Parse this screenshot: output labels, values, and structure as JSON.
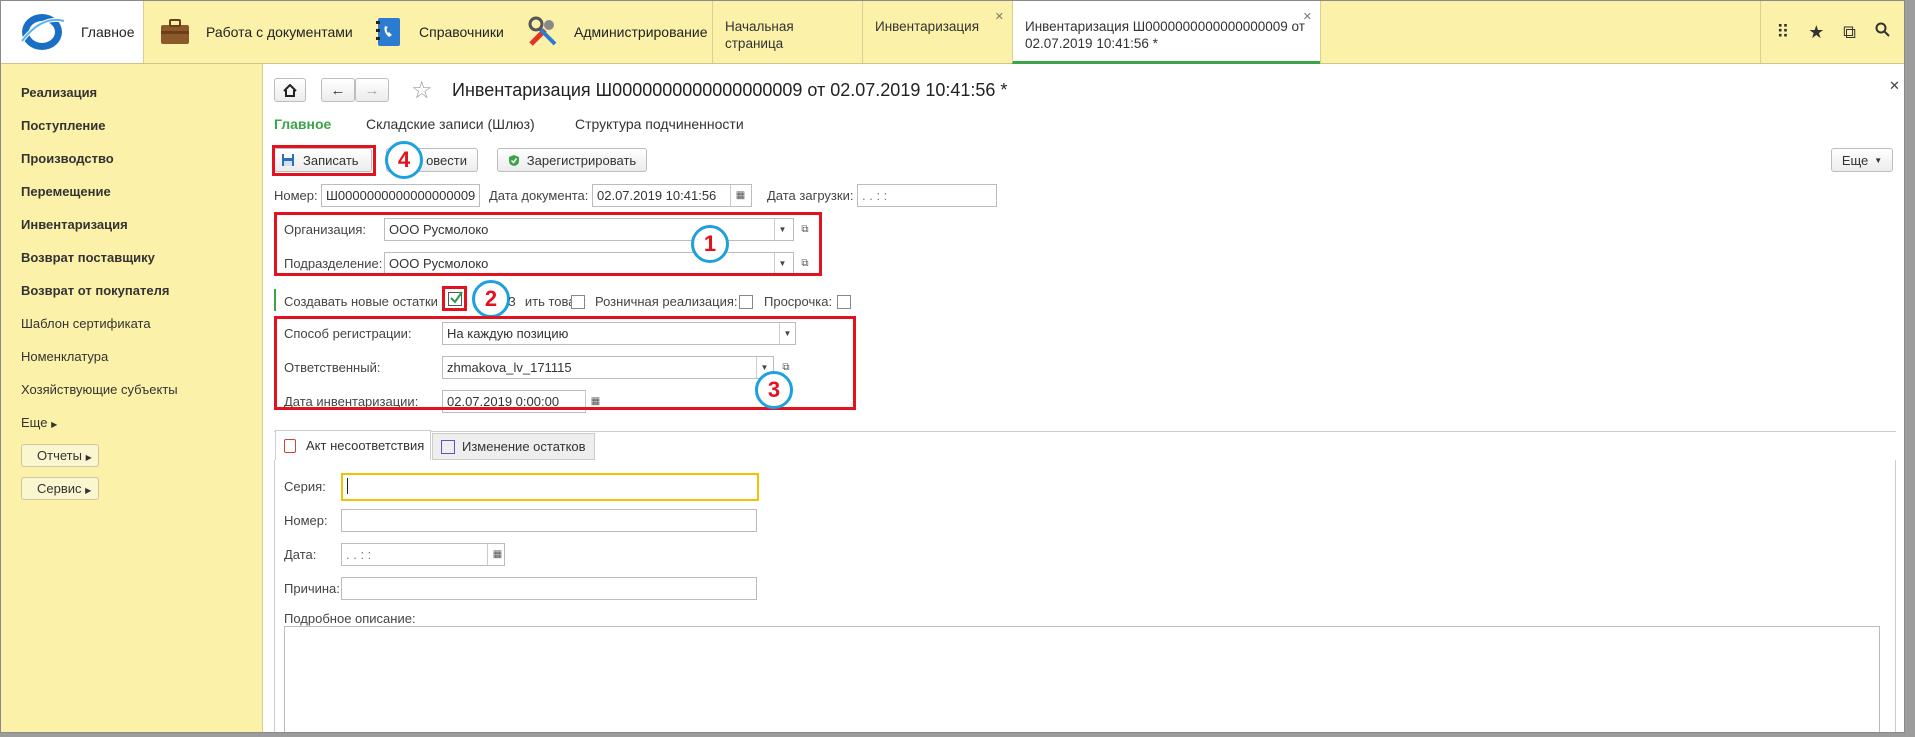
{
  "topbar": {
    "home": "Главное",
    "docs": "Работа с документами",
    "refs": "Справочники",
    "admin": "Администрирование",
    "tabs": [
      {
        "label": "Начальная страница"
      },
      {
        "label": "Инвентаризация"
      },
      {
        "label": "Инвентаризация Ш0000000000000000009 от 02.07.2019 10:41:56 *"
      }
    ]
  },
  "sidebar": {
    "items": [
      "Реализация",
      "Поступление",
      "Производство",
      "Перемещение",
      "Инвентаризация",
      "Возврат поставщику",
      "Возврат от покупателя",
      "Шаблон сертификата",
      "Номенклатура",
      "Хозяйствующие субъекты",
      "Еще"
    ],
    "reports": "Отчеты",
    "service": "Сервис"
  },
  "doc": {
    "title": "Инвентаризация Ш0000000000000000009 от 02.07.2019 10:41:56 *",
    "nav": [
      "Главное",
      "Складские записи (Шлюз)",
      "Структура подчиненности"
    ],
    "save": "Записать",
    "post": "овести",
    "register": "Зарегистрировать",
    "more": "Еще",
    "number_label": "Номер:",
    "number": "Ш0000000000000000009",
    "date_label": "Дата документа:",
    "date": "02.07.2019 10:41:56",
    "load_label": "Дата загрузки:",
    "load_value": " .  .       :  :",
    "org_label": "Организация:",
    "org": "ООО Русмолоко",
    "dept_label": "Подразделение:",
    "dept": "ООО Русмолоко",
    "create_label": "Создавать новые остатки",
    "hidden_label": "З",
    "goods_label": "ить товар:",
    "retail_label": "Розничная реализация:",
    "expired_label": "Просрочка:",
    "reg_label": "Способ регистрации:",
    "reg": "На каждую позицию",
    "resp_label": "Ответственный:",
    "resp": "zhmakova_lv_171115",
    "invdate_label": "Дата инвентаризации:",
    "invdate": "02.07.2019  0:00:00",
    "tabs": [
      "Акт несоответствия",
      "Изменение остатков"
    ],
    "series_label": "Серия:",
    "anum_label": "Номер:",
    "adate_label": "Дата:",
    "adate": " .  .       :  :",
    "reason_label": "Причина:",
    "desc_label": "Подробное описание:"
  },
  "annotations": [
    "1",
    "2",
    "3",
    "4"
  ],
  "colors": {
    "accent": "#3ba34a",
    "highlight": "#e3121f",
    "circle": "#1da0e0",
    "panel": "#fbf1a9"
  }
}
